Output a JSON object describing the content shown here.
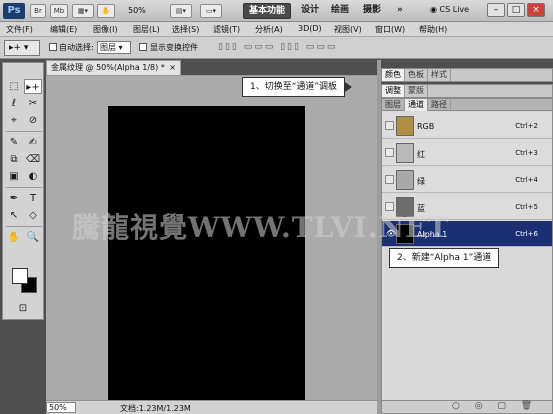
{
  "app": {
    "logo": "Ps",
    "br_label": "Br",
    "mb_label": "Mb",
    "zoom": "50%",
    "workspaces": [
      "基本功能",
      "设计",
      "绘画",
      "摄影"
    ],
    "more": "»",
    "cslive": "CS Live"
  },
  "window_controls": [
    "–",
    "□",
    "×"
  ],
  "menu": [
    "文件(F)",
    "编辑(E)",
    "图像(I)",
    "图层(L)",
    "选择(S)",
    "滤镜(T)",
    "分析(A)",
    "3D(D)",
    "视图(V)",
    "窗口(W)",
    "帮助(H)"
  ],
  "options": {
    "auto_select_label": "自动选择:",
    "auto_select_value": "图层",
    "show_transform_label": "显示变换控件",
    "align_icons": "▯▯▯ ▭▭▭ ▯▯▯ ▭▭▭"
  },
  "document": {
    "tab_title": "金属纹理 @ 50%(Alpha 1/8) *",
    "tab_close": "×",
    "canvas_color": "#000000"
  },
  "tools": [
    "▸+",
    "⬚",
    "ℓ",
    "✂",
    "⌖",
    "⊘",
    "✎",
    "✍",
    "⧉",
    "⌫",
    "▣",
    "◐",
    "✒",
    "T",
    "↖",
    "◇",
    "✋",
    "🔍"
  ],
  "tools_extra": "⊡",
  "panels": {
    "group1_tabs": [
      "颜色",
      "色板",
      "样式"
    ],
    "group2_tabs": [
      "调整",
      "蒙版"
    ],
    "channel_tabs": [
      "图层",
      "通道",
      "路径"
    ],
    "channels": [
      {
        "name": "RGB",
        "shortcut": "Ctrl+2",
        "thumb": "#b08f45",
        "visible": false
      },
      {
        "name": "红",
        "shortcut": "Ctrl+3",
        "thumb": "#b9b9b9",
        "visible": false
      },
      {
        "name": "绿",
        "shortcut": "Ctrl+4",
        "thumb": "#a9a9a9",
        "visible": false
      },
      {
        "name": "蓝",
        "shortcut": "Ctrl+5",
        "thumb": "#6d6d6d",
        "visible": false
      },
      {
        "name": "Alpha 1",
        "shortcut": "Ctrl+6",
        "thumb": "#000000",
        "visible": true
      }
    ],
    "eye_glyph": "👁",
    "footer_icons": "○ ◎ ▢ 🗑"
  },
  "status": {
    "zoom": "50%",
    "doc_info": "文档:1.23M/1.23M"
  },
  "callouts": {
    "step1": "1、切换至“通道”调板",
    "step2": "2、新建“Alpha 1”通道"
  },
  "watermark": "騰龍視覺WWW.TLVI.NET",
  "colors": {
    "selected_channel": "#1d2f73",
    "canvas": "#000000"
  }
}
